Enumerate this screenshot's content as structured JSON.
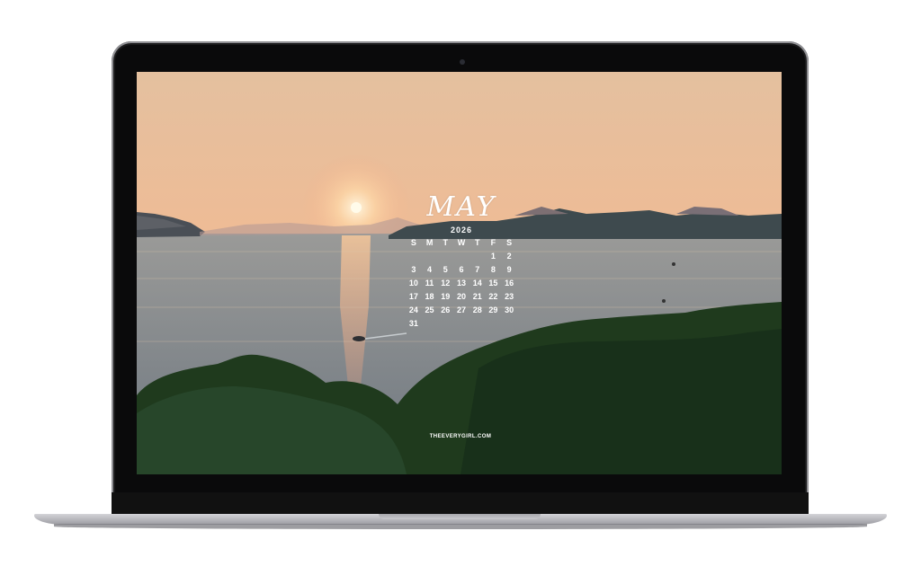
{
  "calendar": {
    "month": "MAY",
    "year": "2026",
    "weekdays": [
      "S",
      "M",
      "T",
      "W",
      "T",
      "F",
      "S"
    ],
    "first_weekday_index": 5,
    "days_in_month": 31
  },
  "watermark": "THEEVERYGIRL.COM",
  "colors": {
    "sky_top": "#e6c09c",
    "sky_horizon": "#f3b08a",
    "sea": "#8b8f92",
    "trees": "#1d3a1a",
    "text": "#ffffff"
  }
}
